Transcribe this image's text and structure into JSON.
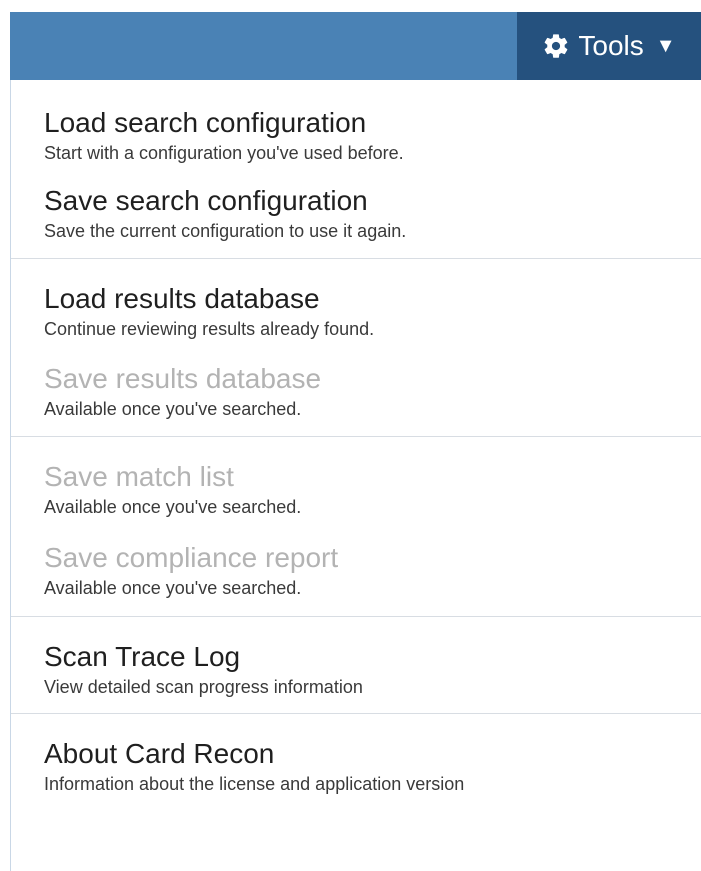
{
  "toolbar": {
    "tools_label": "Tools",
    "tools_icon": "gear-icon",
    "caret_icon": "caret-down-icon",
    "colors": {
      "bar": "#4a82b5",
      "button": "#25517e"
    }
  },
  "menu": {
    "items": [
      {
        "title": "Load search configuration",
        "desc": "Start with a configuration you've used before.",
        "enabled": true
      },
      {
        "title": "Save search configuration",
        "desc": "Save the current configuration to use it again.",
        "enabled": true
      },
      {
        "title": "Load results database",
        "desc": "Continue reviewing results already found.",
        "enabled": true
      },
      {
        "title": "Save results database",
        "desc": "Available once you've searched.",
        "enabled": false
      },
      {
        "title": "Save match list",
        "desc": "Available once you've searched.",
        "enabled": false
      },
      {
        "title": "Save compliance report",
        "desc": "Available once you've searched.",
        "enabled": false
      },
      {
        "title": "Scan Trace Log",
        "desc": "View detailed scan progress information",
        "enabled": true
      },
      {
        "title": "About Card Recon",
        "desc": "Information about the license and application version",
        "enabled": true
      }
    ]
  }
}
